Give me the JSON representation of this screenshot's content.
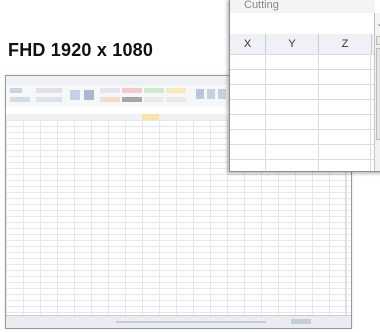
{
  "title": "FHD 1920 x 1080",
  "zoom_panel": {
    "cell_label": "Cutting",
    "columns": [
      "X",
      "Y",
      "Z"
    ]
  },
  "colors": {
    "grid": "#e4e7ec",
    "ribbon": "#f6f7f9",
    "panel_border": "#8e8e8e"
  }
}
